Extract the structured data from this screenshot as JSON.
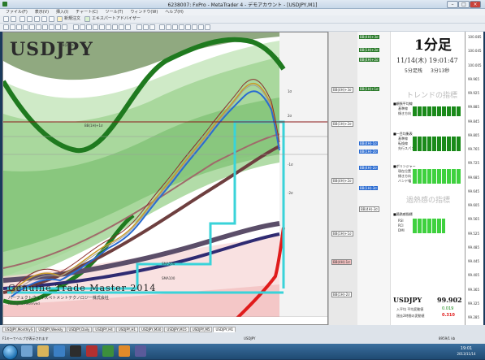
{
  "window": {
    "title": "6238007: FxPro - MetaTrader 4 - デモアカウント - [USDJPY,M1]"
  },
  "menu": [
    "ファイル(F)",
    "表示(V)",
    "挿入(I)",
    "チャート(C)",
    "ツール(T)",
    "ウィンドウ(W)",
    "ヘルプ(H)"
  ],
  "toolbar": {
    "new_order": "新規注文",
    "expert_advisor": "エキスパートアドバイザー"
  },
  "chart": {
    "symbol": "USDJPY",
    "watermark": "Genuine Trade Master 2014",
    "copyright": "パーフェクトウェイスペトメントテクノロジー株式会社",
    "sub_note": "All Rights Reserved",
    "labels": {
      "line_top_left": "BB(2H)+3σ",
      "line_mid_left": "BB(1H)+1σ",
      "short_1": "1σ",
      "short_2": "2σ",
      "short_3": "-1σ",
      "short_4": "-2σ",
      "ma_lbl_1": "SMA200",
      "ma_lbl_2": "SMA100"
    }
  },
  "rail": {
    "tags": [
      "BB(4H)+3σ",
      "BB(1H)+2σ",
      "BB(4H)+2σ",
      "BB(1H)+1σ",
      "BB(4H)-1σ",
      "BB(1H)-2σ",
      "BB(4H)-2σ",
      "BB(1H)-3σ",
      "BB(4H)-3σ"
    ]
  },
  "panel": {
    "timeframe": "1分足",
    "datetime": "11/14(木) 19:01:47",
    "candle_remaining_label": "5分足残",
    "candle_remaining_value": "3分13秒",
    "trend_header": "トレンドの指標",
    "trend_sections": [
      {
        "title": "■順張平均線",
        "rows": [
          "基準線",
          "傾き方向"
        ]
      },
      {
        "title": "■一目均衡表",
        "rows": [
          "基準線",
          "転換線",
          "先行スパン"
        ]
      },
      {
        "title": "■ボリンジャー",
        "rows": [
          "現在位置",
          "傾き方向",
          "バンド幅"
        ]
      }
    ],
    "overheat_header": "過熱感の指標",
    "overheat_sections": [
      {
        "title": "■過熱感指標",
        "rows": [
          "RSI",
          "RCI",
          "DMI"
        ]
      }
    ],
    "symbol": "USDJPY",
    "price": "99.902",
    "stat1_label": "入平均 平均変動値",
    "stat1_value": "0.019",
    "stat2_label": "過去2時間の変動値",
    "stat2_value": "0.310"
  },
  "price_scale": [
    "100.085",
    "100.045",
    "100.005",
    "99.965",
    "99.925",
    "99.885",
    "99.845",
    "99.805",
    "99.765",
    "99.725",
    "99.685",
    "99.645",
    "99.605",
    "99.565",
    "99.525",
    "99.485",
    "99.445",
    "99.405",
    "99.365",
    "99.325",
    "99.285"
  ],
  "tabs": [
    "USDJPY,MonthlyS",
    "USDJPY,Weekly",
    "USDJPY,Daily",
    "USDJPY,H4",
    "USDJPY,H1",
    "USDJPY,M30",
    "USDJPY,M15",
    "USDJPY,M5",
    "USDJPY,M1"
  ],
  "status": {
    "help": "F1キーでヘルプが表示されます",
    "symbol": "USDJPY",
    "memory": "8959/1 kb"
  },
  "clock": {
    "time": "19:01",
    "date": "2013/11/14"
  },
  "colors": {
    "accent": "#1c6fb0",
    "down": "#e01b1b",
    "up": "#1a8a1a"
  }
}
